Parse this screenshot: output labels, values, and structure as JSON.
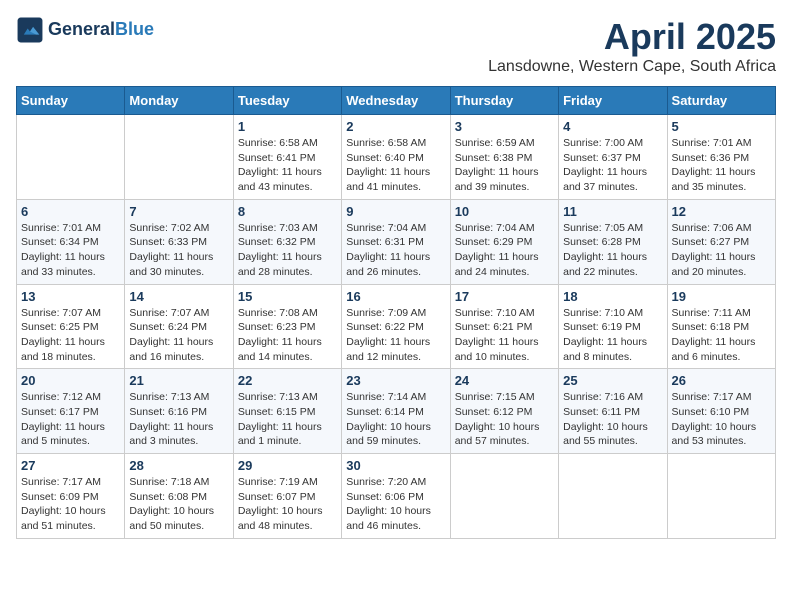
{
  "header": {
    "logo_line1": "General",
    "logo_line2": "Blue",
    "month": "April 2025",
    "location": "Lansdowne, Western Cape, South Africa"
  },
  "weekdays": [
    "Sunday",
    "Monday",
    "Tuesday",
    "Wednesday",
    "Thursday",
    "Friday",
    "Saturday"
  ],
  "weeks": [
    [
      {
        "day": "",
        "info": ""
      },
      {
        "day": "",
        "info": ""
      },
      {
        "day": "1",
        "info": "Sunrise: 6:58 AM\nSunset: 6:41 PM\nDaylight: 11 hours and 43 minutes."
      },
      {
        "day": "2",
        "info": "Sunrise: 6:58 AM\nSunset: 6:40 PM\nDaylight: 11 hours and 41 minutes."
      },
      {
        "day": "3",
        "info": "Sunrise: 6:59 AM\nSunset: 6:38 PM\nDaylight: 11 hours and 39 minutes."
      },
      {
        "day": "4",
        "info": "Sunrise: 7:00 AM\nSunset: 6:37 PM\nDaylight: 11 hours and 37 minutes."
      },
      {
        "day": "5",
        "info": "Sunrise: 7:01 AM\nSunset: 6:36 PM\nDaylight: 11 hours and 35 minutes."
      }
    ],
    [
      {
        "day": "6",
        "info": "Sunrise: 7:01 AM\nSunset: 6:34 PM\nDaylight: 11 hours and 33 minutes."
      },
      {
        "day": "7",
        "info": "Sunrise: 7:02 AM\nSunset: 6:33 PM\nDaylight: 11 hours and 30 minutes."
      },
      {
        "day": "8",
        "info": "Sunrise: 7:03 AM\nSunset: 6:32 PM\nDaylight: 11 hours and 28 minutes."
      },
      {
        "day": "9",
        "info": "Sunrise: 7:04 AM\nSunset: 6:31 PM\nDaylight: 11 hours and 26 minutes."
      },
      {
        "day": "10",
        "info": "Sunrise: 7:04 AM\nSunset: 6:29 PM\nDaylight: 11 hours and 24 minutes."
      },
      {
        "day": "11",
        "info": "Sunrise: 7:05 AM\nSunset: 6:28 PM\nDaylight: 11 hours and 22 minutes."
      },
      {
        "day": "12",
        "info": "Sunrise: 7:06 AM\nSunset: 6:27 PM\nDaylight: 11 hours and 20 minutes."
      }
    ],
    [
      {
        "day": "13",
        "info": "Sunrise: 7:07 AM\nSunset: 6:25 PM\nDaylight: 11 hours and 18 minutes."
      },
      {
        "day": "14",
        "info": "Sunrise: 7:07 AM\nSunset: 6:24 PM\nDaylight: 11 hours and 16 minutes."
      },
      {
        "day": "15",
        "info": "Sunrise: 7:08 AM\nSunset: 6:23 PM\nDaylight: 11 hours and 14 minutes."
      },
      {
        "day": "16",
        "info": "Sunrise: 7:09 AM\nSunset: 6:22 PM\nDaylight: 11 hours and 12 minutes."
      },
      {
        "day": "17",
        "info": "Sunrise: 7:10 AM\nSunset: 6:21 PM\nDaylight: 11 hours and 10 minutes."
      },
      {
        "day": "18",
        "info": "Sunrise: 7:10 AM\nSunset: 6:19 PM\nDaylight: 11 hours and 8 minutes."
      },
      {
        "day": "19",
        "info": "Sunrise: 7:11 AM\nSunset: 6:18 PM\nDaylight: 11 hours and 6 minutes."
      }
    ],
    [
      {
        "day": "20",
        "info": "Sunrise: 7:12 AM\nSunset: 6:17 PM\nDaylight: 11 hours and 5 minutes."
      },
      {
        "day": "21",
        "info": "Sunrise: 7:13 AM\nSunset: 6:16 PM\nDaylight: 11 hours and 3 minutes."
      },
      {
        "day": "22",
        "info": "Sunrise: 7:13 AM\nSunset: 6:15 PM\nDaylight: 11 hours and 1 minute."
      },
      {
        "day": "23",
        "info": "Sunrise: 7:14 AM\nSunset: 6:14 PM\nDaylight: 10 hours and 59 minutes."
      },
      {
        "day": "24",
        "info": "Sunrise: 7:15 AM\nSunset: 6:12 PM\nDaylight: 10 hours and 57 minutes."
      },
      {
        "day": "25",
        "info": "Sunrise: 7:16 AM\nSunset: 6:11 PM\nDaylight: 10 hours and 55 minutes."
      },
      {
        "day": "26",
        "info": "Sunrise: 7:17 AM\nSunset: 6:10 PM\nDaylight: 10 hours and 53 minutes."
      }
    ],
    [
      {
        "day": "27",
        "info": "Sunrise: 7:17 AM\nSunset: 6:09 PM\nDaylight: 10 hours and 51 minutes."
      },
      {
        "day": "28",
        "info": "Sunrise: 7:18 AM\nSunset: 6:08 PM\nDaylight: 10 hours and 50 minutes."
      },
      {
        "day": "29",
        "info": "Sunrise: 7:19 AM\nSunset: 6:07 PM\nDaylight: 10 hours and 48 minutes."
      },
      {
        "day": "30",
        "info": "Sunrise: 7:20 AM\nSunset: 6:06 PM\nDaylight: 10 hours and 46 minutes."
      },
      {
        "day": "",
        "info": ""
      },
      {
        "day": "",
        "info": ""
      },
      {
        "day": "",
        "info": ""
      }
    ]
  ]
}
